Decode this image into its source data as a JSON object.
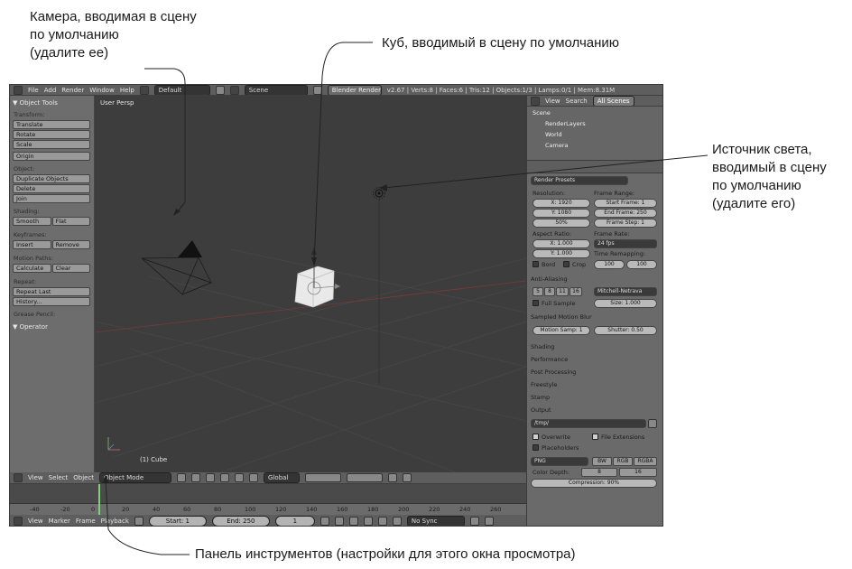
{
  "annotations": {
    "camera": "Камера, вводимая в сцену\nпо умолчанию\n(удалите ее)",
    "cube": "Куб, вводимый в сцену по умолчанию",
    "light": "Источник света,\nвводимый в сцену\nпо умолчанию\n(удалите его)",
    "toolbar": "Панель инструментов (настройки для этого окна просмотра)"
  },
  "top_header": {
    "menus": [
      "File",
      "Add",
      "Render",
      "Window",
      "Help"
    ],
    "layout": "Default",
    "scene": "Scene",
    "engine": "Blender Render",
    "stats": "v2.67 | Verts:8 | Faces:6 | Tris:12 | Objects:1/3 | Lamps:0/1 | Mem:8.31M"
  },
  "tool_shelf": {
    "title": "▼ Object Tools",
    "transform_label": "Transform:",
    "translate": "Translate",
    "rotate": "Rotate",
    "scale": "Scale",
    "origin": "Origin",
    "object_label": "Object:",
    "duplicate": "Duplicate Objects",
    "delete": "Delete",
    "join": "Join",
    "shading_label": "Shading:",
    "smooth": "Smooth",
    "flat": "Flat",
    "keyframes_label": "Keyframes:",
    "insert": "Insert",
    "remove": "Remove",
    "motion_label": "Motion Paths:",
    "calculate": "Calculate",
    "clear": "Clear",
    "repeat_label": "Repeat:",
    "repeat_last": "Repeat Last",
    "history": "History...",
    "grease_label": "Grease Pencil:",
    "operator": "▼ Operator"
  },
  "viewport": {
    "label": "User Persp",
    "object_label": "(1) Cube"
  },
  "outliner": {
    "view": "View",
    "search": "Search",
    "all_scenes": "All Scenes",
    "scene": "Scene",
    "render_layers": "RenderLayers",
    "world": "World",
    "camera": "Camera"
  },
  "properties": {
    "render_presets": "Render Presets",
    "resolution": "Resolution:",
    "res_x": "X: 1920",
    "res_y": "Y: 1080",
    "res_pct": "50%",
    "frame_range": "Frame Range:",
    "start_frame": "Start Frame: 1",
    "end_frame": "End Frame: 250",
    "frame_step": "Frame Step: 1",
    "aspect_ratio": "Aspect Ratio:",
    "asp_x": "X: 1.000",
    "asp_y": "Y: 1.000",
    "frame_rate": "Frame Rate:",
    "fps": "24 fps",
    "time_remap": "Time Remapping:",
    "remap_old": "100",
    "remap_new": "100",
    "border": "Bord",
    "crop": "Crop",
    "anti_aliasing": "Anti-Aliasing",
    "aa_5": "5",
    "aa_8": "8",
    "aa_11": "11",
    "aa_16": "16",
    "filter": "Mitchell-Netrava",
    "full_sample": "Full Sample",
    "size": "Size: 1.000",
    "motion_blur": "Sampled Motion Blur",
    "motion_samples": "Motion Samp: 1",
    "shutter": "Shutter: 0.50",
    "shading": "Shading",
    "performance": "Performance",
    "post_processing": "Post Processing",
    "freestyle": "Freestyle",
    "stamp": "Stamp",
    "output": "Output",
    "output_path": "/tmp/",
    "overwrite": "Overwrite",
    "file_extensions": "File Extensions",
    "placeholders": "Placeholders",
    "format": "PNG",
    "bw": "BW",
    "rgb": "RGB",
    "rgba": "RGBA",
    "color_depth": "Color Depth:",
    "depth_8": "8",
    "depth_16": "16",
    "compression": "Compression: 90%"
  },
  "view_header": {
    "view": "View",
    "select": "Select",
    "object": "Object",
    "mode": "Object Mode",
    "orientation": "Global"
  },
  "timeline": {
    "ticks": [
      "-40",
      "-20",
      "0",
      "20",
      "40",
      "60",
      "80",
      "100",
      "120",
      "140",
      "160",
      "180",
      "200",
      "220",
      "240",
      "260"
    ],
    "view": "View",
    "marker": "Marker",
    "frame": "Frame",
    "playback": "Playback",
    "start": "Start: 1",
    "end": "End: 250",
    "current": "1",
    "sync": "No Sync"
  }
}
